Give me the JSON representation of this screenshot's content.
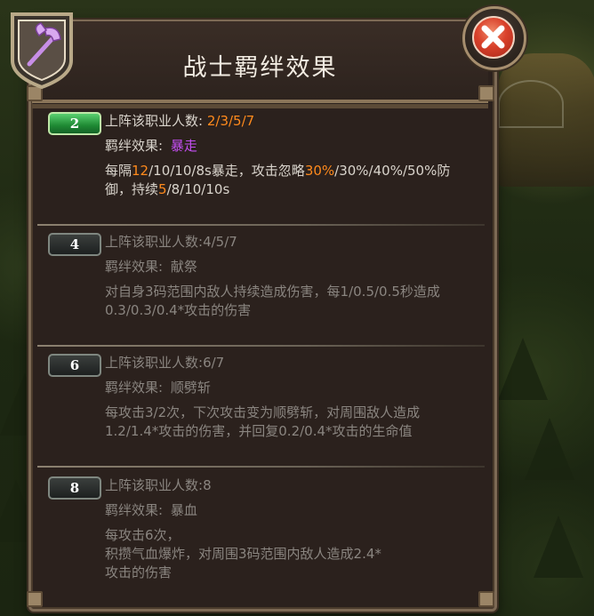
{
  "window": {
    "title": "战士羁绊效果",
    "close_label": "close"
  },
  "colors": {
    "highlight_orange": "#ff8a1c",
    "effect_purple": "#c44ef2",
    "active_badge": "#1f8a34",
    "inactive_badge": "#1d2020"
  },
  "icons": {
    "emblem": "warrior-axe-icon",
    "close": "close-icon"
  },
  "tiers": [
    {
      "level": "2",
      "active": true,
      "count_label": "上阵该职业人数:",
      "count_value": "2/3/5/7",
      "effect_label": "羁绊效果:",
      "effect_name": "暴走",
      "desc_parts": [
        "每隔",
        "12",
        "/10/10/8s暴走，攻击忽略",
        "30%",
        "/30%/40%/50%防御，持续",
        "5",
        "/8/10/10s"
      ]
    },
    {
      "level": "4",
      "active": false,
      "count_label": "上阵该职业人数:",
      "count_value": "4/5/7",
      "effect_label": "羁绊效果:",
      "effect_name": "献祭",
      "desc": "对自身3码范围内敌人持续造成伤害，每1/0.5/0.5秒造成0.3/0.3/0.4*攻击的伤害"
    },
    {
      "level": "6",
      "active": false,
      "count_label": "上阵该职业人数:",
      "count_value": "6/7",
      "effect_label": "羁绊效果:",
      "effect_name": "顺劈斩",
      "desc": "每攻击3/2次，下次攻击变为顺劈斩，对周围敌人造成1.2/1.4*攻击的伤害，并回复0.2/0.4*攻击的生命值"
    },
    {
      "level": "8",
      "active": false,
      "count_label": "上阵该职业人数:",
      "count_value": "8",
      "effect_label": "羁绊效果:",
      "effect_name": "暴血",
      "desc_lines": [
        "每攻击6次，",
        "积攒气血爆炸，对周围3码范围内敌人造成2.4*",
        "攻击的伤害"
      ]
    }
  ]
}
